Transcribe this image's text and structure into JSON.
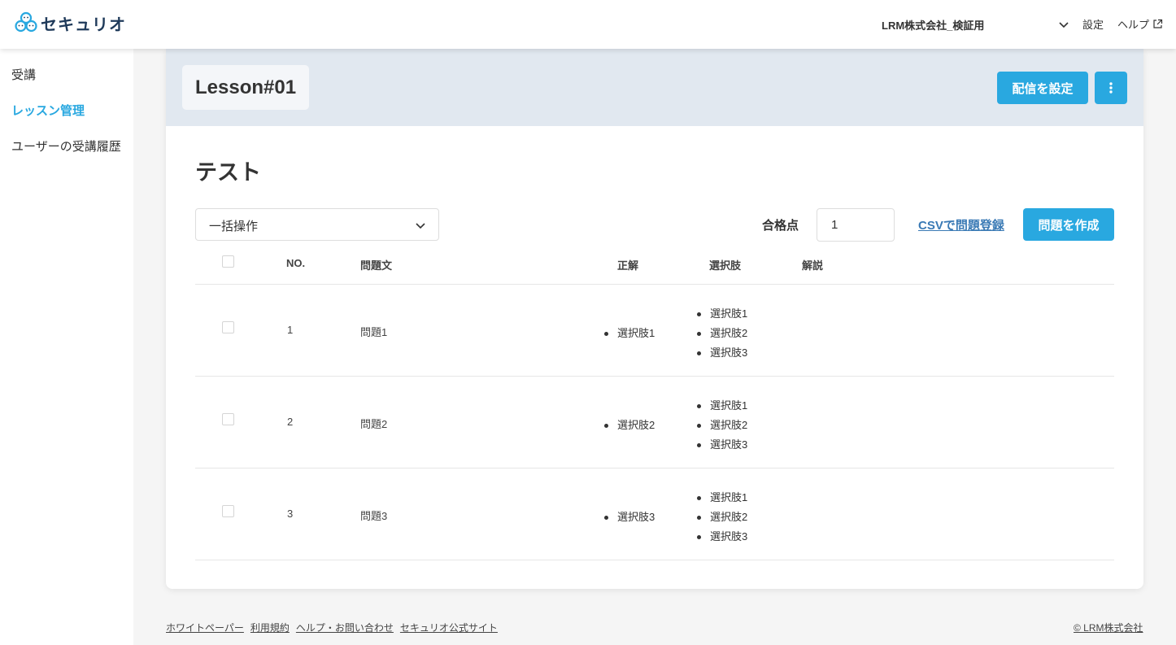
{
  "brand": {
    "name": "セキュリオ"
  },
  "header": {
    "org_name": "LRM株式会社_検証用",
    "settings_label": "設定",
    "help_label": "ヘルプ"
  },
  "sidebar": {
    "items": [
      {
        "label": "受講"
      },
      {
        "label": "レッスン管理",
        "active": true
      },
      {
        "label": "ユーザーの受講履歴"
      }
    ]
  },
  "lesson": {
    "title": "Lesson#01",
    "deliver_button": "配信を設定"
  },
  "section": {
    "title": "テスト"
  },
  "toolbar": {
    "bulk_action": "一括操作",
    "pass_score_label": "合格点",
    "pass_score_value": "1",
    "csv_link": "CSVで問題登録",
    "create_button": "問題を作成"
  },
  "table": {
    "headers": {
      "no": "NO.",
      "question": "問題文",
      "answer": "正解",
      "choices": "選択肢",
      "explanation": "解説"
    },
    "rows": [
      {
        "no": "1",
        "question": "問題1",
        "answer": "選択肢1",
        "choices": [
          "選択肢1",
          "選択肢2",
          "選択肢3"
        ],
        "explanation": ""
      },
      {
        "no": "2",
        "question": "問題2",
        "answer": "選択肢2",
        "choices": [
          "選択肢1",
          "選択肢2",
          "選択肢3"
        ],
        "explanation": ""
      },
      {
        "no": "3",
        "question": "問題3",
        "answer": "選択肢3",
        "choices": [
          "選択肢1",
          "選択肢2",
          "選択肢3"
        ],
        "explanation": ""
      }
    ]
  },
  "footer": {
    "links": [
      "ホワイトペーパー",
      "利用規約",
      "ヘルプ・お問い合わせ",
      "セキュリオ公式サイト"
    ],
    "copyright": "© LRM株式会社"
  },
  "colors": {
    "accent": "#29a8e0",
    "header_band": "#e1e8f0",
    "link": "#3a7ab5",
    "brand_dark": "#1f3a5a"
  },
  "icons": {
    "logo": "people-cluster-icon",
    "caret": "chevron-down-icon",
    "external": "external-link-icon",
    "more": "kebab-menu-icon"
  }
}
